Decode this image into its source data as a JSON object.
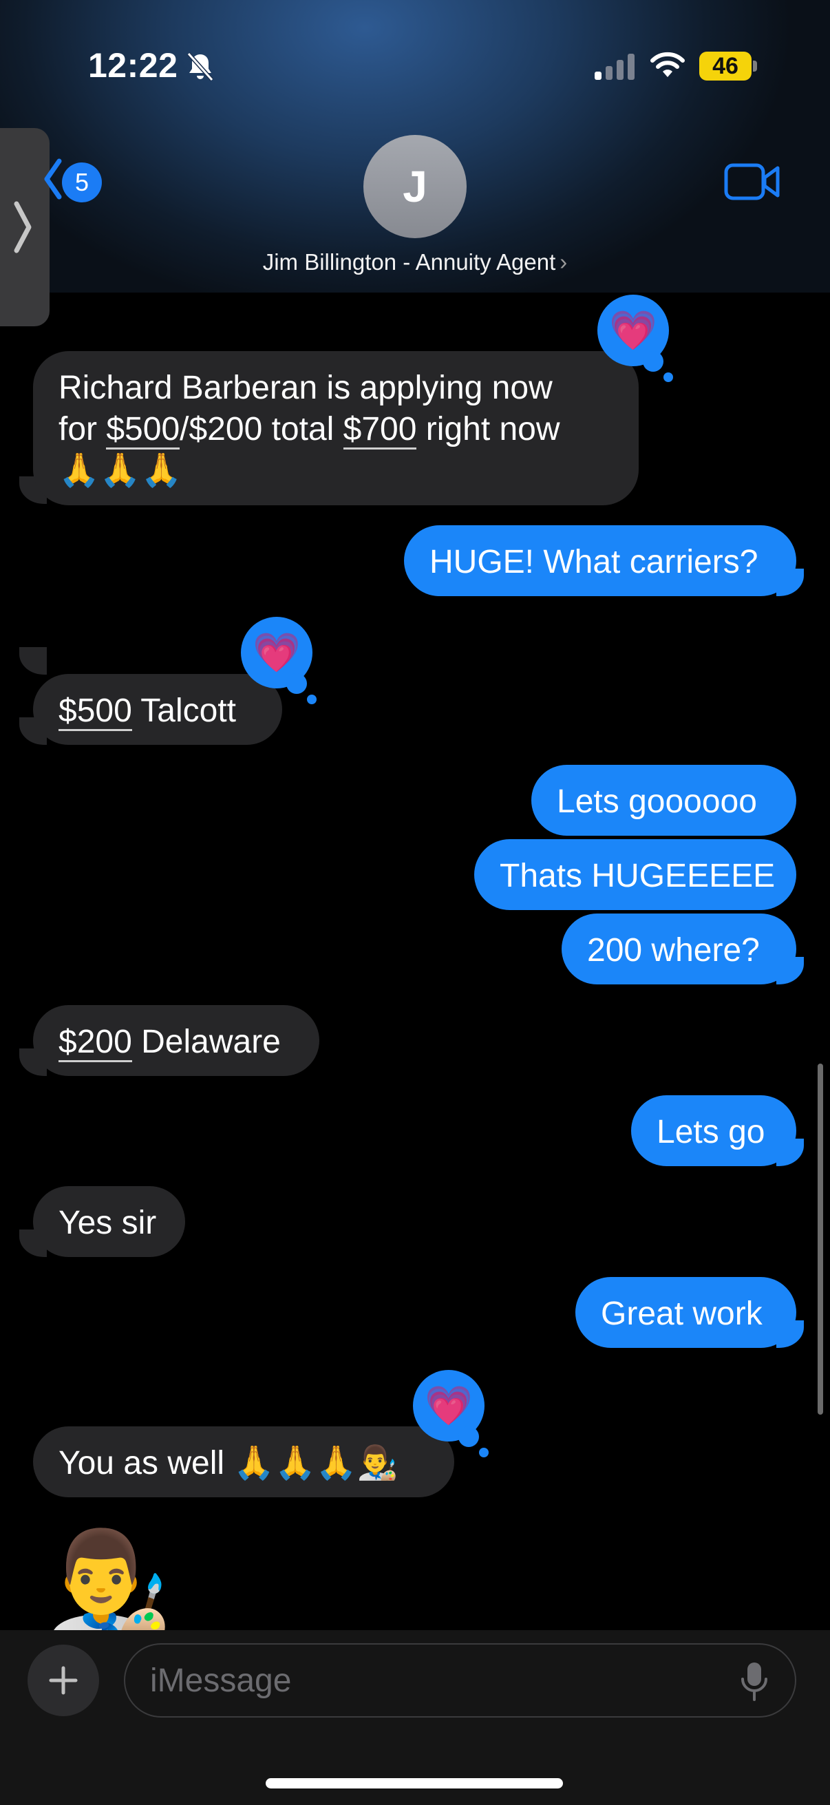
{
  "status_bar": {
    "time": "12:22",
    "battery": "46"
  },
  "header": {
    "back_count": "5",
    "avatar_initial": "J",
    "contact_name": "Jim Billington - Annuity Agent",
    "name_chevron": "›"
  },
  "messages": [
    {
      "side": "in",
      "lines": [
        "Richard Barberan is applying now",
        "for $500/$200 total $700 right now",
        "🙏🙏🙏"
      ],
      "reaction": "💗"
    },
    {
      "side": "out",
      "text": "HUGE! What carriers?"
    },
    {
      "side": "in",
      "text_a": "$500",
      "text_b": " Talcott",
      "reaction": "💗"
    },
    {
      "side": "out",
      "text": "Lets goooooo"
    },
    {
      "side": "out",
      "text": "Thats HUGEEEEE"
    },
    {
      "side": "out",
      "text": "200 where?"
    },
    {
      "side": "in",
      "text_a": "$200",
      "text_b": " Delaware"
    },
    {
      "side": "out",
      "text": "Lets go"
    },
    {
      "side": "in",
      "text": "Yes sir"
    },
    {
      "side": "out",
      "text": "Great work"
    },
    {
      "side": "in",
      "text": "You as well 🙏🙏🙏👨‍🎨",
      "reaction": "💗"
    }
  ],
  "message1_parts": {
    "l2a": "for ",
    "l2b": "$500",
    "l2c": "/$200 total ",
    "l2d": "$700",
    "l2e": " right now"
  },
  "big_emoji": "👨‍🎨",
  "compose": {
    "placeholder": "iMessage"
  },
  "colors": {
    "outgoing": "#1b86f9",
    "incoming": "#262628",
    "background": "#000000"
  },
  "icons": [
    "bell-slash-icon",
    "cellular-signal-icon",
    "wifi-icon",
    "battery-icon",
    "chevron-left-icon",
    "video-camera-icon",
    "plus-icon",
    "microphone-icon",
    "chevron-right-icon"
  ]
}
